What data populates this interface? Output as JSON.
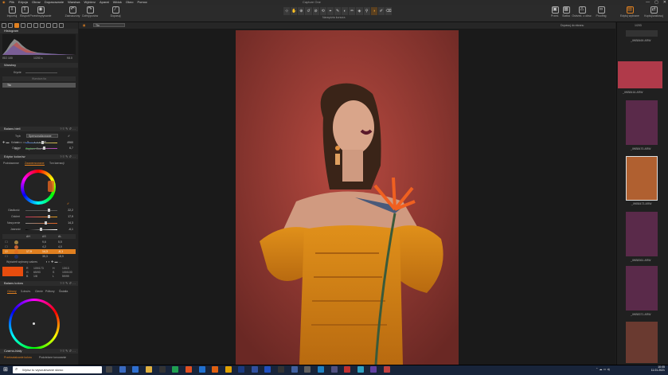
{
  "app": {
    "title": "Capture One"
  },
  "menu": [
    "Plik",
    "Edycja",
    "Obraz",
    "Dopasowanie",
    "Warstwa",
    "Wybierz",
    "Aparat",
    "Widok",
    "Okno",
    "Pomoc"
  ],
  "window_controls": [
    "—",
    "▢",
    "✕"
  ],
  "toolbar": {
    "left_buttons": [
      {
        "label": "Importuj",
        "icon": "import-icon"
      },
      {
        "label": "Eksport",
        "icon": "export-icon"
      },
      {
        "label": "Przechwytywanie",
        "icon": "camera-icon"
      },
      {
        "label": "Zaznaczony",
        "icon": "undo-icon"
      },
      {
        "label": "Cofnij/ponów",
        "icon": "redo-icon"
      },
      {
        "label": "Dopasuj",
        "icon": "wand-icon"
      }
    ],
    "cursor_tools_label": "Narzędzia kursora",
    "cursor_tools": [
      "⊹",
      "✋",
      "⊕",
      "↺",
      "⊘",
      "⟲",
      "⌖",
      "✎",
      "◐",
      "✏",
      "◈",
      "⚲",
      "◑",
      "✐",
      "⌫"
    ],
    "right_buttons": [
      {
        "label": "Przed.",
        "icon": "before-icon"
      },
      {
        "label": "Siatka",
        "icon": "grid-icon"
      },
      {
        "label": "Ostrzeż. o obsz.",
        "icon": "warning-icon"
      },
      {
        "label": "Prooflng",
        "icon": "glasses-icon"
      },
      {
        "label": "Edytuj wybrane",
        "icon": "edit-icon"
      },
      {
        "label": "Kopiuj/zastosuj",
        "icon": "copy-icon"
      }
    ]
  },
  "left_panel": {
    "histogram": {
      "title": "Histogram",
      "iso": "ISO 100",
      "shutter": "1/200 s",
      "aperture": "f/8.0"
    },
    "layers": {
      "title": "Warstwy",
      "opacity_label": "Krycie",
      "layer_name": "Tło",
      "bg_layer": "Warstwa tła"
    },
    "styles_row": [
      "Styl:",
      "Capture One 20"
    ],
    "white_balance": {
      "title": "Balans bieli",
      "mode_label": "Tryb",
      "mode_value": "Spersonalizowane",
      "kelvin_label": "Kelwin",
      "kelvin_value": "4960",
      "tint_label": "Odcień",
      "tint_value": "6,7"
    },
    "color_editor": {
      "title": "Edytor kolorów",
      "tabs": [
        "Podstawowe",
        "Zaawansowane",
        "Ton karnacji"
      ],
      "active_tab": "Zaawansowane",
      "smooth_label": "Gładkość",
      "smooth_value": "22,2",
      "hue_label": "Odcień",
      "hue_value": "17,9",
      "saturation_label": "Nasycenie",
      "saturation_value": "14,3",
      "lightness_label": "Jasność",
      "lightness_value": "-6,1",
      "table_headers": [
        "",
        "ΔH",
        "ΔS",
        "ΔL"
      ],
      "table_rows": [
        {
          "swatch": "#a08040",
          "h": "",
          "s": "9,6",
          "l": "5,5"
        },
        {
          "swatch": "#c06030",
          "h": "",
          "s": "4,2",
          "l": "4,0"
        },
        {
          "swatch": "#e07020",
          "h": "17,9",
          "s": "14,3",
          "l": "-6,1"
        },
        {
          "swatch": "#203060",
          "h": "",
          "s": "35,3",
          "l": "18,9"
        }
      ],
      "extract_label": "Wyświetl wybrany zakres",
      "rgb": {
        "r_label": "R",
        "r": "109/173",
        "g_label": "G",
        "g": "65/93",
        "b_label": "B",
        "b": "1/8",
        "h_label": "H",
        "h": "13/13",
        "s_label": "S",
        "s": "100/100",
        "l_label": "L",
        "l": "59/99"
      }
    },
    "color_balance": {
      "title": "Balans koloru",
      "tabs": [
        "Główny",
        "3-drożn.",
        "Cienie",
        "Półtony",
        "Światła"
      ],
      "active_tab": "Główny"
    },
    "black_white": {
      "title": "Czarno-biały",
      "tabs": [
        "Przekształcanie koloru",
        "Podzielone tonowanie"
      ]
    }
  },
  "viewer": {
    "zoom_label": "Dopasuj do ekranu",
    "counter": "1/203",
    "layer_dropdown": "Tło"
  },
  "browser": {
    "thumbs": [
      {
        "name": "_IWB8469.ARW"
      },
      {
        "name": "_IWB8416.ARW"
      },
      {
        "name": "_IWB8470.ARW"
      },
      {
        "name": "_IWB8473.ARW"
      },
      {
        "name": "_IWB8361.ARW"
      },
      {
        "name": "_IWB8371.ARW"
      }
    ]
  },
  "taskbar": {
    "search_placeholder": "Wpisz tu wyszukiwane słowo",
    "time": "10:05",
    "date": "11.01.2021"
  },
  "colors": {
    "accent": "#e08020",
    "background": "#1d1d1d",
    "panel": "#232323"
  }
}
